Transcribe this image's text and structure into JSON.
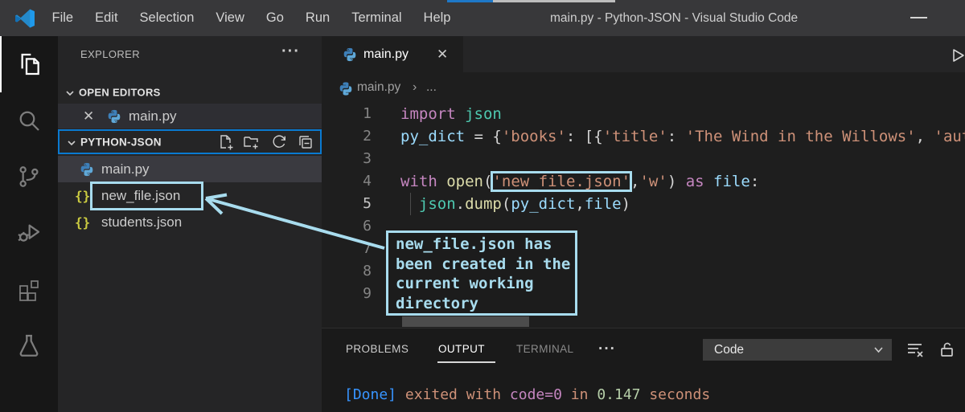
{
  "colors": {
    "annotation": "#a8dcee",
    "focus_border": "#0a7ad1",
    "selection_bg": "#3a3a40",
    "keyword": "#c586c0",
    "string": "#ce9178",
    "variable": "#9cdcfe",
    "function": "#dcdcaa",
    "module": "#4ec9b0",
    "info_blue": "#3794ff",
    "number_green": "#b5cea8"
  },
  "title_bar": {
    "menus": [
      "File",
      "Edit",
      "Selection",
      "View",
      "Go",
      "Run",
      "Terminal",
      "Help"
    ],
    "title": "main.py - Python-JSON - Visual Studio Code"
  },
  "activity_bar": {
    "icons": [
      "explorer",
      "search",
      "source-control",
      "run-and-debug",
      "extensions",
      "testing"
    ],
    "active": "explorer"
  },
  "sidebar": {
    "header": "EXPLORER",
    "more": "···",
    "open_editors": {
      "label": "OPEN EDITORS",
      "items": [
        {
          "name": "main.py",
          "icon": "python",
          "close": "✕"
        }
      ]
    },
    "folder": {
      "label": "PYTHON-JSON",
      "actions": [
        "new-file",
        "new-folder",
        "refresh",
        "collapse-all"
      ],
      "files": [
        {
          "name": "main.py",
          "icon": "python",
          "selected": true
        },
        {
          "name": "new_file.json",
          "icon": "json",
          "boxed": true
        },
        {
          "name": "students.json",
          "icon": "json"
        }
      ]
    }
  },
  "editor": {
    "tab": {
      "label": "main.py",
      "close": "✕"
    },
    "breadcrumb": {
      "file": "main.py",
      "sep": "›",
      "rest": "..."
    },
    "code": {
      "lines": [
        {
          "num": 1,
          "tokens": [
            [
              "import",
              "kw"
            ],
            [
              " ",
              "pl"
            ],
            [
              "json",
              "typ"
            ]
          ]
        },
        {
          "num": 2,
          "tokens": [
            [
              "py_dict",
              "var"
            ],
            [
              " = {",
              "pl"
            ],
            [
              "'books'",
              "str"
            ],
            [
              ": [{",
              "pl"
            ],
            [
              "'title'",
              "str"
            ],
            [
              ": ",
              "pl"
            ],
            [
              "'The Wind in the Willows'",
              "str"
            ],
            [
              ", ",
              "pl"
            ],
            [
              "'aut",
              "str"
            ]
          ]
        },
        {
          "num": 3,
          "tokens": []
        },
        {
          "num": 4,
          "tokens": [
            [
              "with",
              "kw"
            ],
            [
              " ",
              "pl"
            ],
            [
              "open",
              "fn"
            ],
            [
              "(",
              "pl"
            ],
            [
              "'new_file.json'",
              "str boxed"
            ],
            [
              ",",
              "pl"
            ],
            [
              "'w'",
              "str"
            ],
            [
              ") ",
              "pl"
            ],
            [
              "as",
              "kw"
            ],
            [
              " ",
              "pl"
            ],
            [
              "file",
              "var"
            ],
            [
              ":",
              "pl"
            ]
          ]
        },
        {
          "num": 5,
          "active": true,
          "guide": true,
          "tokens": [
            [
              "  ",
              "pl"
            ],
            [
              "json",
              "typ"
            ],
            [
              ".",
              "pl"
            ],
            [
              "dump",
              "fn"
            ],
            [
              "(",
              "pl"
            ],
            [
              "py_dict",
              "var"
            ],
            [
              ",",
              "pl"
            ],
            [
              "file",
              "var"
            ],
            [
              ")",
              "pl"
            ]
          ]
        },
        {
          "num": 6,
          "tokens": []
        },
        {
          "num": 7,
          "tokens": []
        },
        {
          "num": 8,
          "tokens": []
        },
        {
          "num": 9,
          "tokens": []
        }
      ]
    }
  },
  "annotation": {
    "text": "new_file.json has\nbeen created in the\ncurrent working\ndirectory"
  },
  "panel": {
    "tabs": [
      {
        "label": "PROBLEMS"
      },
      {
        "label": "OUTPUT",
        "active": true
      },
      {
        "label": "TERMINAL",
        "dim": true
      }
    ],
    "more": "···",
    "dropdown": {
      "value": "Code"
    },
    "output_tokens": [
      [
        "[Done]",
        "blue"
      ],
      [
        " exited with ",
        "orange"
      ],
      [
        "code=0",
        "purple"
      ],
      [
        " in ",
        "orange"
      ],
      [
        "0.147",
        "green"
      ],
      [
        " seconds",
        "orange"
      ]
    ]
  }
}
